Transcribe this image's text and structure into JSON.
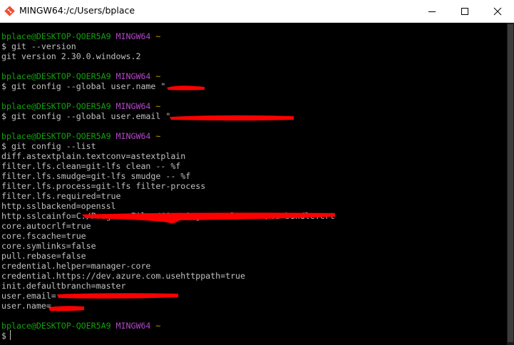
{
  "window": {
    "title": "MINGW64:/c/Users/bplace",
    "accent": "#f14e32"
  },
  "colors": {
    "background": "#000000",
    "text": "#c0c0c0",
    "prompt_user": "#13a10e",
    "prompt_host": "#b148c6",
    "prompt_path": "#c19c00",
    "redaction": "#ff0000"
  },
  "prompt": {
    "user_host": "bplace@DESKTOP-QOER5A9",
    "shell": "MINGW64",
    "path": "~",
    "symbol": "$"
  },
  "lines": [
    {
      "kind": "prompt"
    },
    {
      "kind": "cmd",
      "text": "$ git --version"
    },
    {
      "kind": "out",
      "text": "git version 2.30.0.windows.2"
    },
    {
      "kind": "blank"
    },
    {
      "kind": "prompt"
    },
    {
      "kind": "cmd",
      "text": "$ git config --global user.name \""
    },
    {
      "kind": "blank"
    },
    {
      "kind": "prompt"
    },
    {
      "kind": "cmd",
      "text": "$ git config --global user.email \""
    },
    {
      "kind": "blank"
    },
    {
      "kind": "prompt"
    },
    {
      "kind": "cmd",
      "text": "$ git config --list"
    },
    {
      "kind": "out",
      "text": "diff.astextplain.textconv=astextplain"
    },
    {
      "kind": "out",
      "text": "filter.lfs.clean=git-lfs clean -- %f"
    },
    {
      "kind": "out",
      "text": "filter.lfs.smudge=git-lfs smudge -- %f"
    },
    {
      "kind": "out",
      "text": "filter.lfs.process=git-lfs filter-process"
    },
    {
      "kind": "out",
      "text": "filter.lfs.required=true"
    },
    {
      "kind": "out",
      "text": "http.sslbackend=openssl"
    },
    {
      "kind": "out",
      "text": "http.sslcainfo=C:/Program Files/Git/mingw64/ssl/certs/ca-bundle.crt"
    },
    {
      "kind": "out",
      "text": "core.autocrlf=true"
    },
    {
      "kind": "out",
      "text": "core.fscache=true"
    },
    {
      "kind": "out",
      "text": "core.symlinks=false"
    },
    {
      "kind": "out",
      "text": "pull.rebase=false"
    },
    {
      "kind": "out",
      "text": "credential.helper=manager-core"
    },
    {
      "kind": "out",
      "text": "credential.https://dev.azure.com.usehttppath=true"
    },
    {
      "kind": "out",
      "text": "init.defaultbranch=master"
    },
    {
      "kind": "out",
      "text": "user.email="
    },
    {
      "kind": "out",
      "text": "user.name="
    },
    {
      "kind": "blank"
    },
    {
      "kind": "prompt"
    },
    {
      "kind": "cmd",
      "text": "$ "
    }
  ]
}
